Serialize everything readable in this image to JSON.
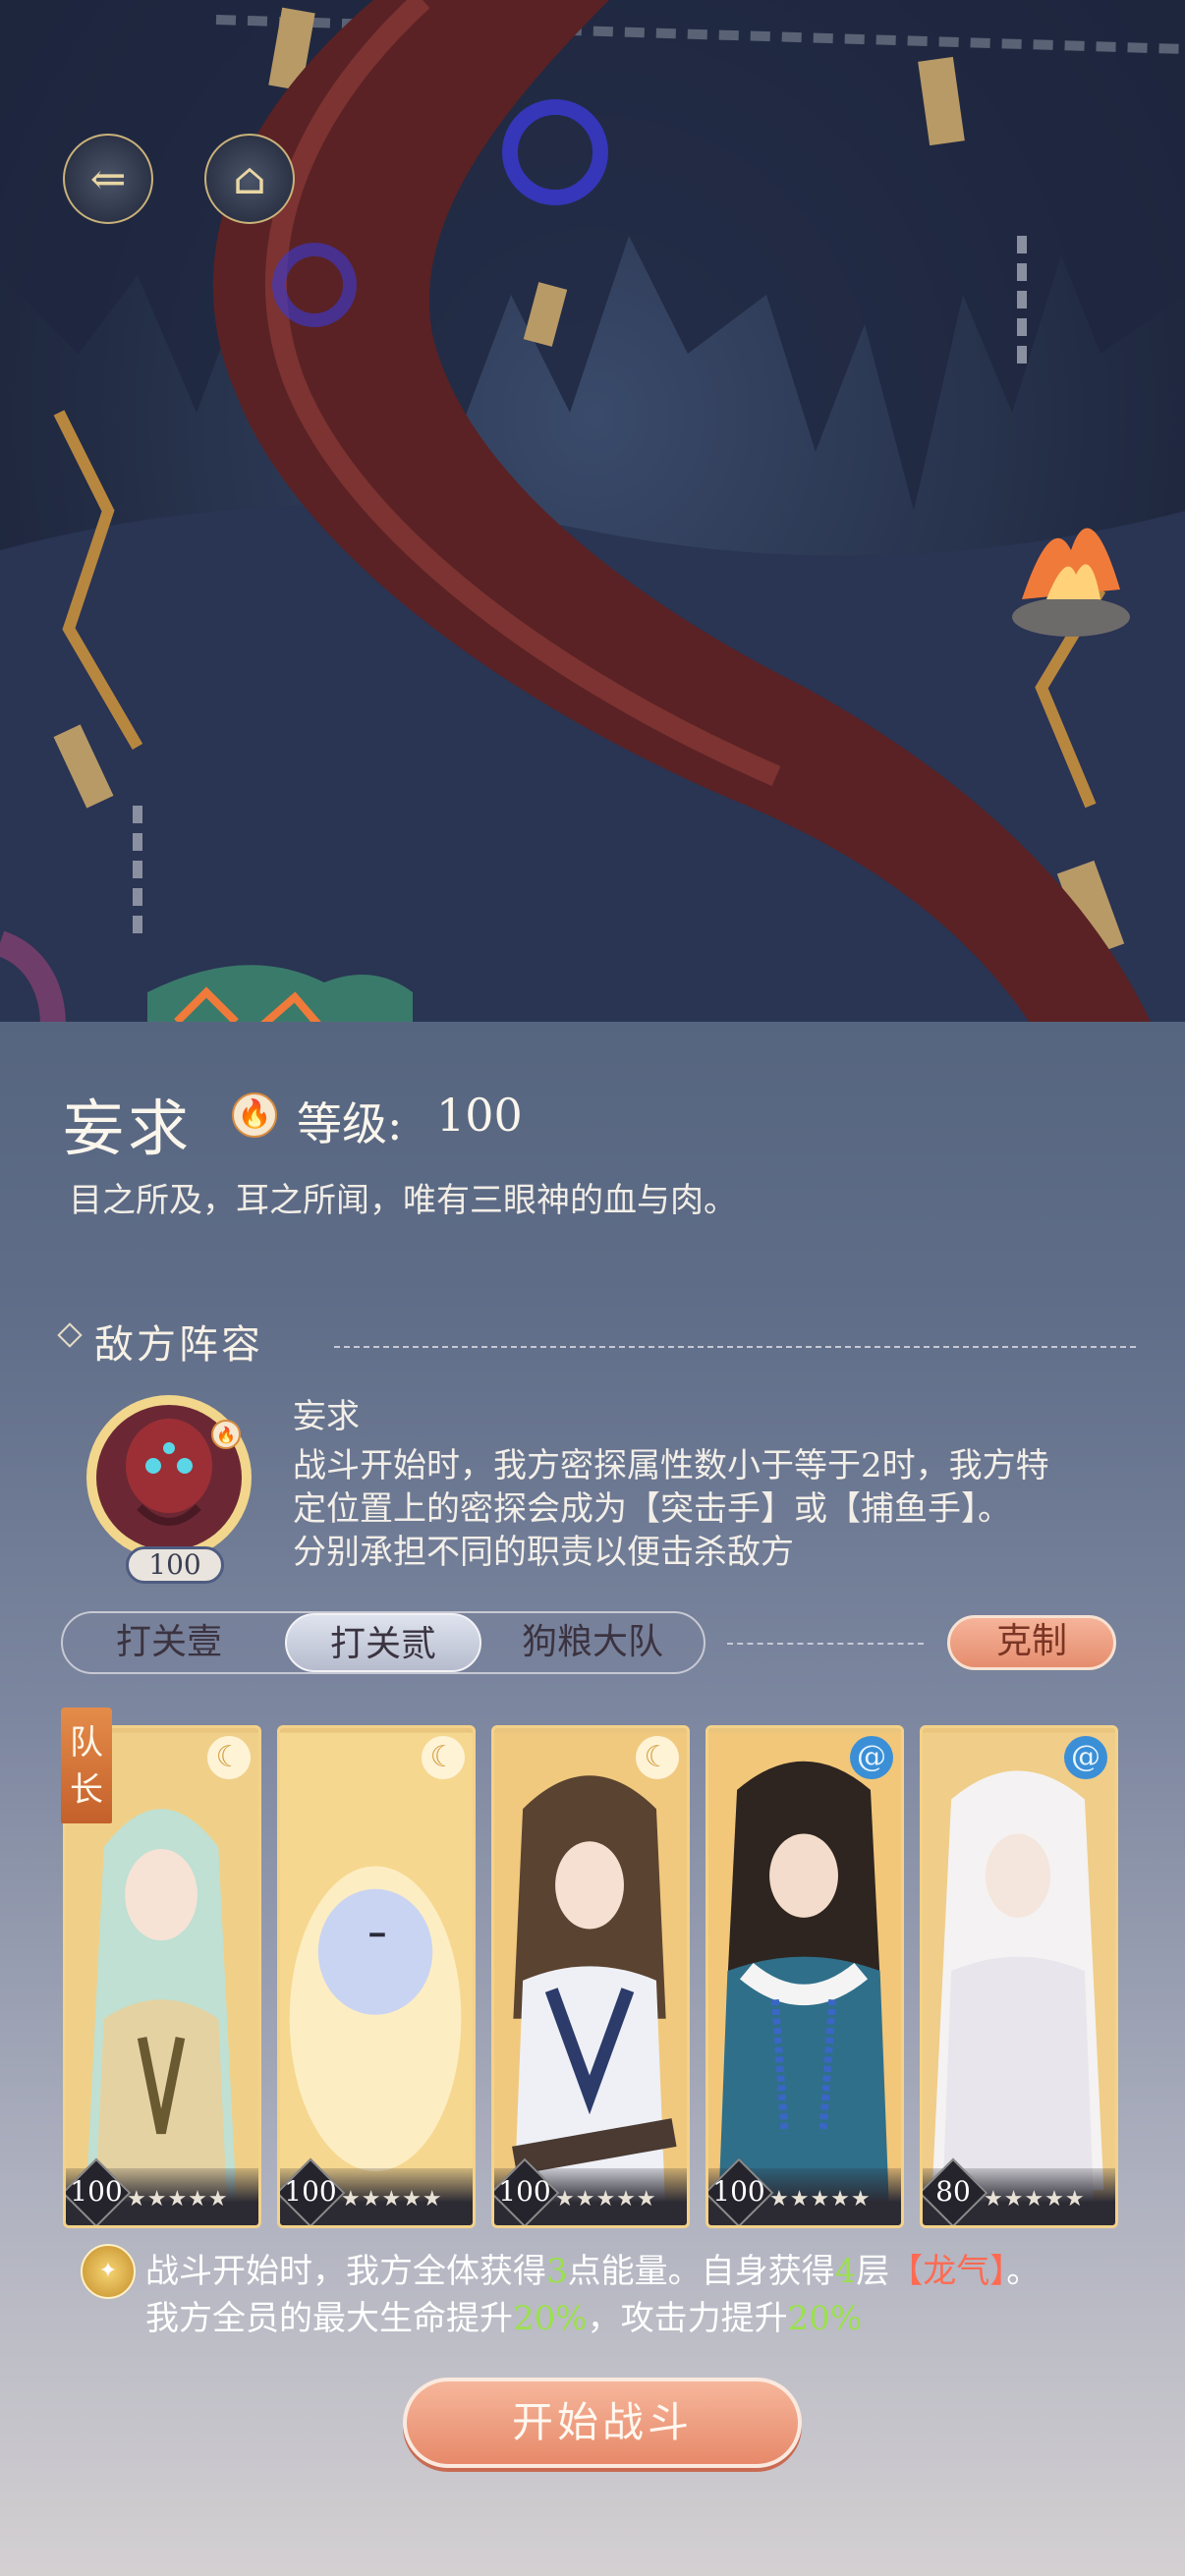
{
  "nav": {
    "back_icon": "back-arrow-icon",
    "home_icon": "pavilion-icon"
  },
  "boss": {
    "name": "妄求",
    "level_label": "等级:",
    "level_value": "100",
    "description": "目之所及，耳之所闻，唯有三眼神的血与肉。"
  },
  "enemy_section": {
    "title": "敌方阵容",
    "enemy_name": "妄求",
    "enemy_level": "100",
    "desc_line1": "战斗开始时，我方密探属性数小于等于2时，我方特",
    "desc_line2": "定位置上的密探会成为【突击手】或【捕鱼手】。",
    "desc_line3": "分别承担不同的职责以便击杀敌方"
  },
  "tabs": [
    {
      "label": "打关壹",
      "active": false
    },
    {
      "label": "打关贰",
      "active": true
    },
    {
      "label": "狗粮大队",
      "active": false
    }
  ],
  "counter_label": "克制",
  "team": {
    "leader_tag": "队长",
    "cards": [
      {
        "level": "100",
        "element": "moon",
        "element_icon": "crescent-moon-icon"
      },
      {
        "level": "100",
        "element": "moon",
        "element_icon": "crescent-moon-icon"
      },
      {
        "level": "100",
        "element": "moon",
        "element_icon": "crescent-moon-icon"
      },
      {
        "level": "100",
        "element": "water",
        "element_icon": "swirl-icon"
      },
      {
        "level": "80",
        "element": "water",
        "element_icon": "swirl-icon"
      }
    ],
    "stars": "★★★★★"
  },
  "skill": {
    "l1_a": "战斗开始时，我方全体获得",
    "l1_n1": "3",
    "l1_b": "点能量。自身获得",
    "l1_n2": "4",
    "l1_c": "层",
    "l1_tag": "【龙气】",
    "l1_d": "。",
    "l2_a": "我方全员的最大生命提升",
    "l2_n1": "20%",
    "l2_b": "，攻击力提升",
    "l2_n2": "20%"
  },
  "start_button": "开始战斗",
  "colors": {
    "accent": "#e7896a",
    "highlight_green": "#9be04d",
    "highlight_red": "#ff6a52"
  }
}
